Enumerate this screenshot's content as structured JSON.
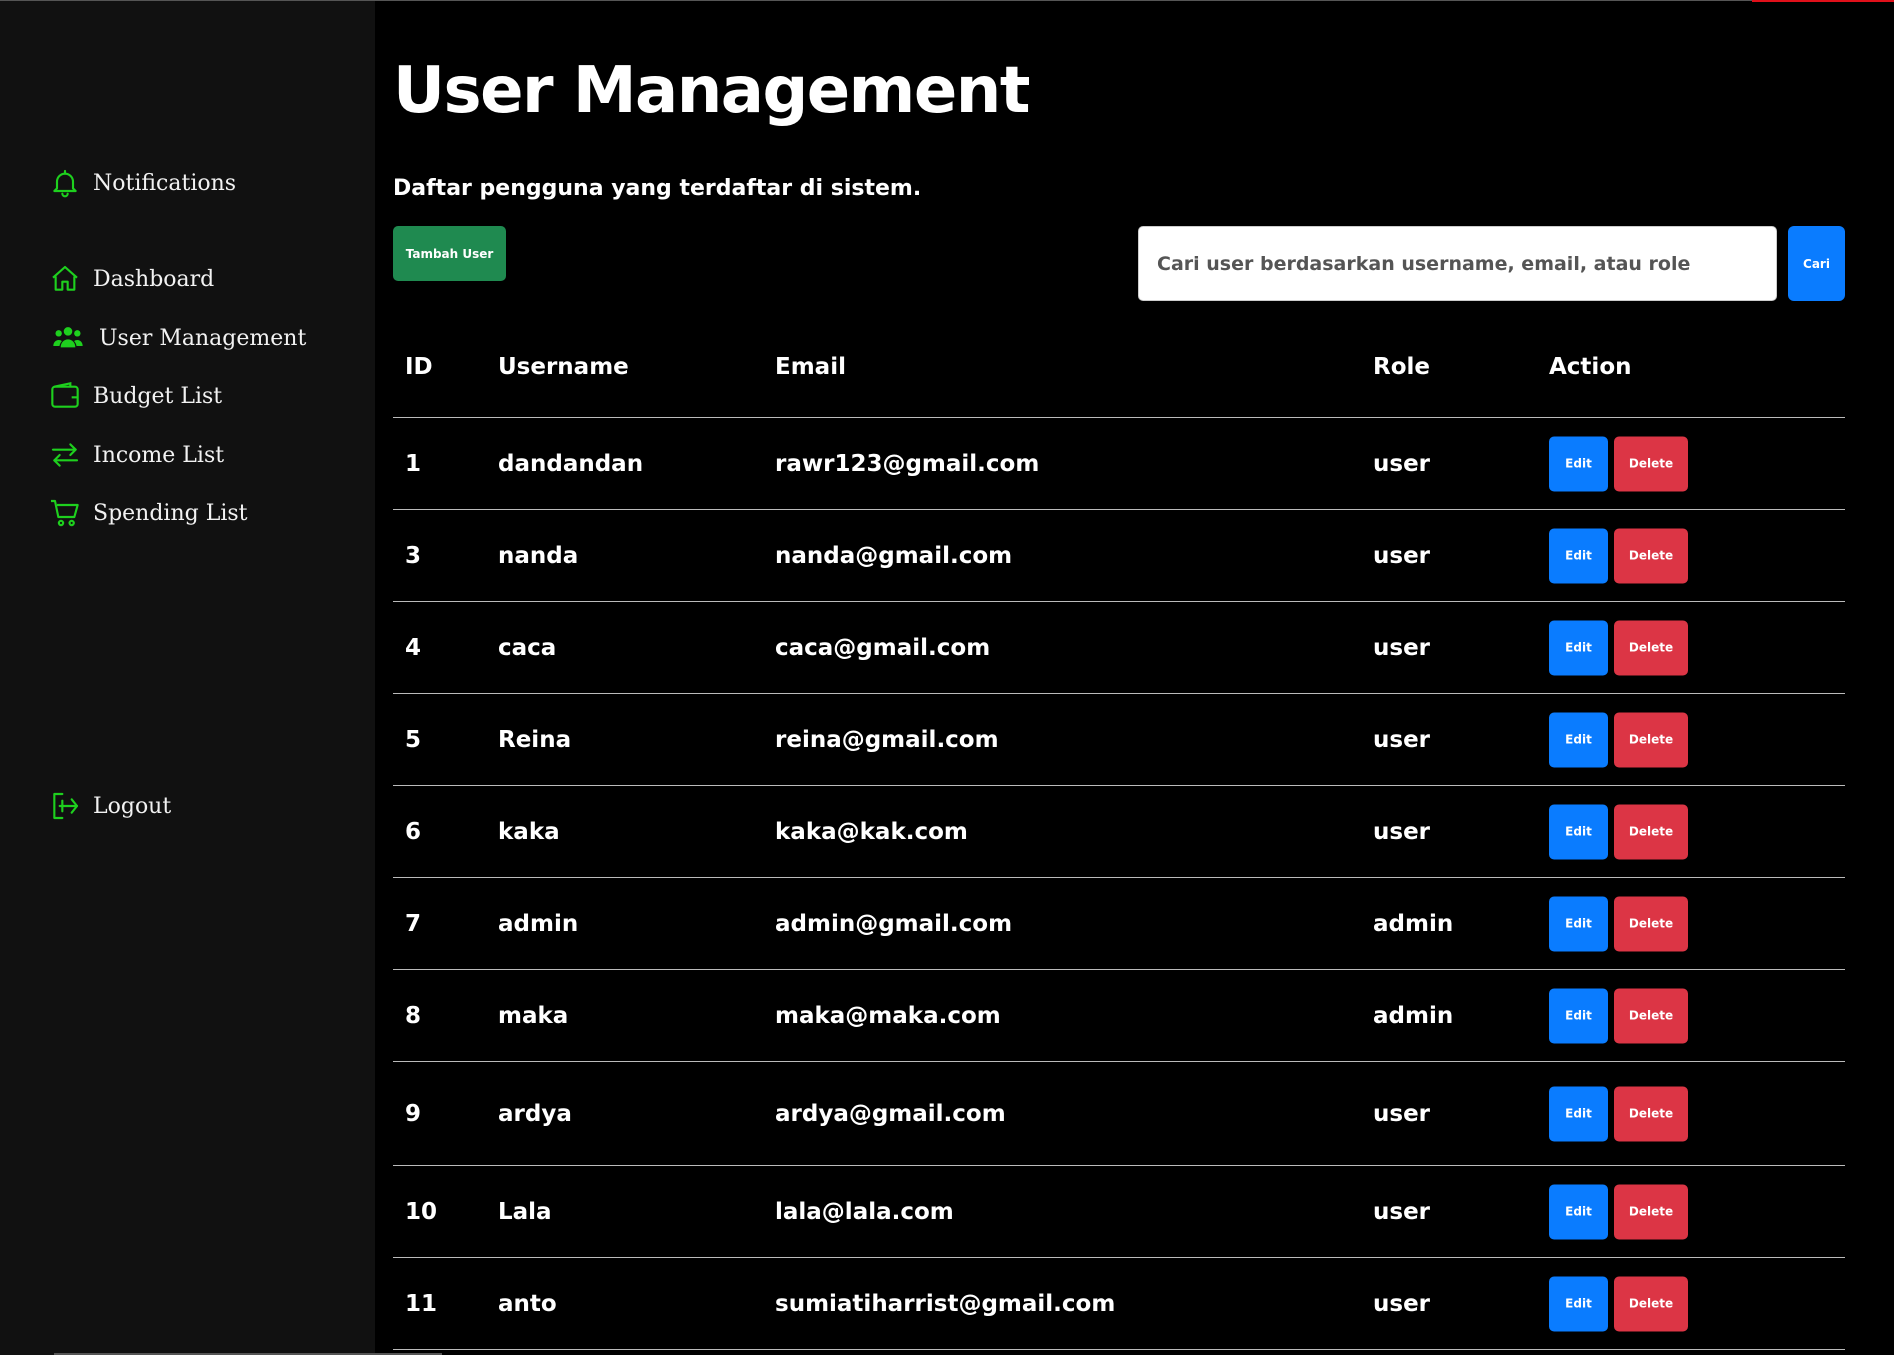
{
  "sidebar": {
    "notifications": {
      "label": "Notifications",
      "icon": "bell-icon"
    },
    "items": [
      {
        "label": "Dashboard",
        "icon": "home-icon"
      },
      {
        "label": "User Management",
        "icon": "users-icon"
      },
      {
        "label": "Budget List",
        "icon": "wallet-icon"
      },
      {
        "label": "Income List",
        "icon": "transfer-icon"
      },
      {
        "label": "Spending List",
        "icon": "cart-icon"
      }
    ],
    "logout": {
      "label": "Logout",
      "icon": "logout-icon"
    },
    "icon_color": "#1ed01e"
  },
  "main": {
    "title": "User Management",
    "subtitle": "Daftar pengguna yang terdaftar di sistem.",
    "add_button": "Tambah User",
    "search": {
      "placeholder": "Cari user berdasarkan username, email, atau role",
      "button": "Cari"
    }
  },
  "table": {
    "headers": {
      "id": "ID",
      "username": "Username",
      "email": "Email",
      "role": "Role",
      "action": "Action"
    },
    "edit_label": "Edit",
    "delete_label": "Delete",
    "rows": [
      {
        "id": "1",
        "username": "dandandan",
        "email": "rawr123@gmail.com",
        "role": "user"
      },
      {
        "id": "3",
        "username": "nanda",
        "email": "nanda@gmail.com",
        "role": "user"
      },
      {
        "id": "4",
        "username": "caca",
        "email": "caca@gmail.com",
        "role": "user"
      },
      {
        "id": "5",
        "username": "Reina",
        "email": "reina@gmail.com",
        "role": "user"
      },
      {
        "id": "6",
        "username": "kaka",
        "email": "kaka@kak.com",
        "role": "user"
      },
      {
        "id": "7",
        "username": "admin",
        "email": "admin@gmail.com",
        "role": "admin"
      },
      {
        "id": "8",
        "username": "maka",
        "email": "maka@maka.com",
        "role": "admin"
      },
      {
        "id": "9",
        "username": "ardya",
        "email": "ardya@gmail.com",
        "role": "user"
      },
      {
        "id": "10",
        "username": "Lala",
        "email": "lala@lala.com",
        "role": "user"
      },
      {
        "id": "11",
        "username": "anto",
        "email": "sumiatiharrist@gmail.com",
        "role": "user"
      }
    ]
  },
  "colors": {
    "add_button": "#1f8a50",
    "edit_button": "#0a7cff",
    "delete_button": "#dc3545",
    "sidebar_bg": "#111111"
  }
}
